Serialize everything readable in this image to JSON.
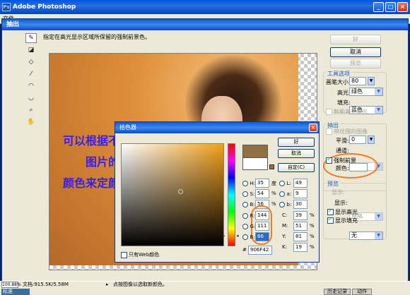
{
  "app": {
    "title": "Adobe Photoshop",
    "menu": "文件"
  },
  "status": {
    "zoom": "100.88%",
    "doc": "文档:915.5K/5.58M",
    "hint": "点按图像以选取新颜色。",
    "mode": "标准",
    "tab_history": "历史记录",
    "tab_actions": "动作"
  },
  "extract": {
    "title": "抽出",
    "hint": "指定在高光显示区域所保留的强制前景色。",
    "overlay_lines": [
      "可以根据不同",
      "图片的",
      "颜色来定颜色"
    ],
    "buttons": {
      "ok": "好",
      "cancel": "取消",
      "preview": "预览"
    },
    "tool_options": {
      "title": "工具选项",
      "brush_size_label": "画笔大小:",
      "brush_size": "80",
      "highlight_label": "高光:",
      "highlight": "绿色",
      "fill_label": "填充:",
      "fill": "蓝色",
      "smart_highlight": "智能高光显示"
    },
    "extraction": {
      "title": "抽出",
      "textured": "带纹理的图像",
      "smooth_label": "平滑:",
      "smooth": "0",
      "channel_label": "通道:",
      "channel": "无",
      "force_fg": "强制前景",
      "color_label": "颜色:"
    },
    "preview_group": {
      "title": "预览",
      "show_label": "显示:",
      "show": "原稿",
      "display_label": "显示:",
      "display": "无",
      "show_highlight": "显示高光",
      "show_fill": "显示填充"
    }
  },
  "picker": {
    "title": "拾色器",
    "buttons": {
      "ok": "好",
      "cancel": "取消",
      "custom": "自定(C)"
    },
    "hsb": [
      {
        "k": "H:",
        "v": "35",
        "u": "度"
      },
      {
        "k": "S:",
        "v": "54",
        "u": "%"
      },
      {
        "k": "B:",
        "v": "56",
        "u": "%"
      }
    ],
    "rgb": [
      {
        "k": "R:",
        "v": "144"
      },
      {
        "k": "G:",
        "v": "111"
      },
      {
        "k": "B:",
        "v": "66"
      }
    ],
    "lab": [
      {
        "k": "L:",
        "v": "49"
      },
      {
        "k": "a:",
        "v": "9"
      },
      {
        "k": "b:",
        "v": "30"
      }
    ],
    "cmyk": [
      {
        "k": "C:",
        "v": "39",
        "u": "%"
      },
      {
        "k": "M:",
        "v": "51",
        "u": "%"
      },
      {
        "k": "Y:",
        "v": "81",
        "u": "%"
      },
      {
        "k": "K:",
        "v": "19",
        "u": "%"
      }
    ],
    "hex_label": "#",
    "hex": "906F42",
    "web_only": "只有Web颜色",
    "new_color": "#906f42",
    "old_color": "#ffffff"
  },
  "icons": [
    "edge-highlighter-icon",
    "fill-icon",
    "eraser-icon",
    "eyedropper-icon",
    "cleanup-icon",
    "edge-touchup-icon",
    "zoom-icon",
    "hand-icon"
  ]
}
